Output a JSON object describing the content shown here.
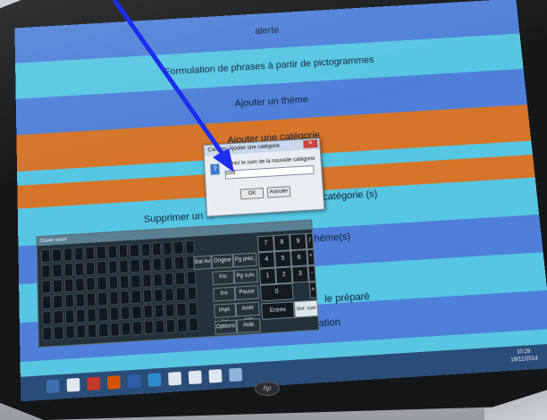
{
  "screen": {
    "menu_items": [
      "alerte",
      "Formulation de phrases à partir de pictogrammes",
      "Ajouter un thème",
      "Ajouter une catégorie",
      "Supprimer un ..."
    ],
    "partial_texts": {
      "supprimer_categorie": "des catégorie (s)",
      "supprimer_theme": "thème(s)",
      "prepare": "le préparé",
      "programmation": "Aide à la Programmation"
    }
  },
  "dialog": {
    "title": "Confirm: Ajouter une catégorie",
    "question_icon": "?",
    "label": "Entrez le nom de la nouvelle catégorie",
    "input_value": "tsfsd",
    "ok_label": "OK",
    "cancel_label": "Annuler"
  },
  "keyboard": {
    "title": "Clavier visuel",
    "side_keys": [
      "Bat Av",
      "Origine",
      "Pg préc.",
      "Fin",
      "Pg suiv.",
      "Ins",
      "Pause",
      "Impr. écr.",
      "Arrêt défil",
      "Options",
      "Aide"
    ],
    "numpad": [
      "7",
      "8",
      "9",
      "/",
      "4",
      "5",
      "6",
      "*",
      "1",
      "2",
      "3",
      "-",
      "0",
      "+"
    ],
    "enter_label": "Entrée",
    "numlock_label": "Verr. num"
  },
  "taskbar": {
    "clock_time": "10:28",
    "clock_date": "18/11/2014"
  },
  "overlay": {
    "arrow_color": "#1b2ef0"
  },
  "brand": "hp",
  "colors": {
    "band_blue": "#4f7fd8",
    "band_cyan": "#57c6e2",
    "band_orange": "#d4752b",
    "taskbar": "#2a4c78"
  }
}
